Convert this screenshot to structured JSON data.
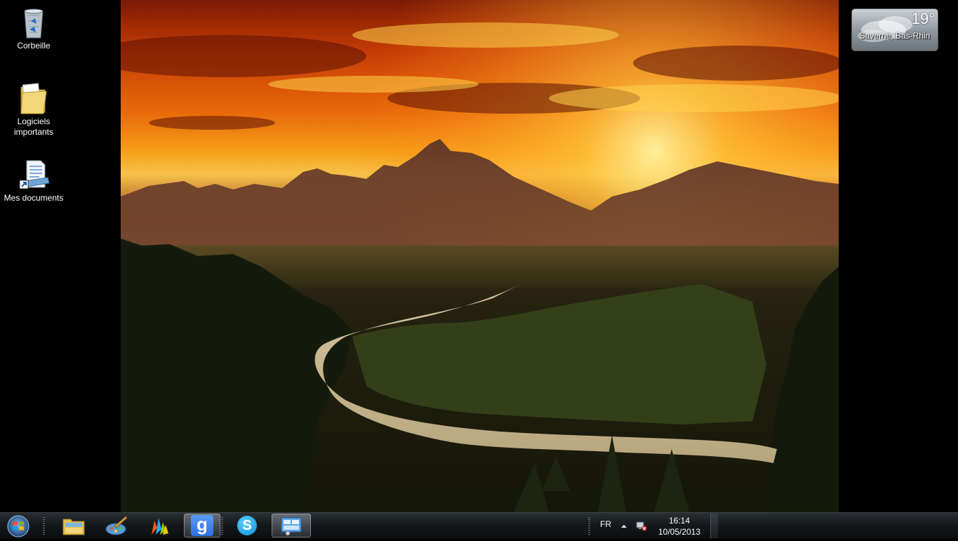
{
  "desktop": {
    "icons": [
      {
        "label": "Corbeille",
        "icon": "recycle-bin-icon"
      },
      {
        "label": "Logiciels importants",
        "icon": "folder-icon"
      },
      {
        "label": "Mes documents",
        "icon": "documents-shortcut-icon"
      }
    ]
  },
  "weather_gadget": {
    "temperature": "19°",
    "location": "Saverne, Bas-Rhin"
  },
  "taskbar": {
    "pinned": [
      {
        "icon": "file-explorer-icon"
      },
      {
        "icon": "paint-brush-icon"
      },
      {
        "icon": "windows-live-messenger-icon"
      },
      {
        "icon": "google-icon",
        "text": "g"
      },
      {
        "icon": "skype-icon",
        "text": "S"
      },
      {
        "icon": "control-panel-icon"
      }
    ],
    "tray": {
      "language": "FR",
      "time": "16:14",
      "date": "10/05/2013"
    }
  }
}
